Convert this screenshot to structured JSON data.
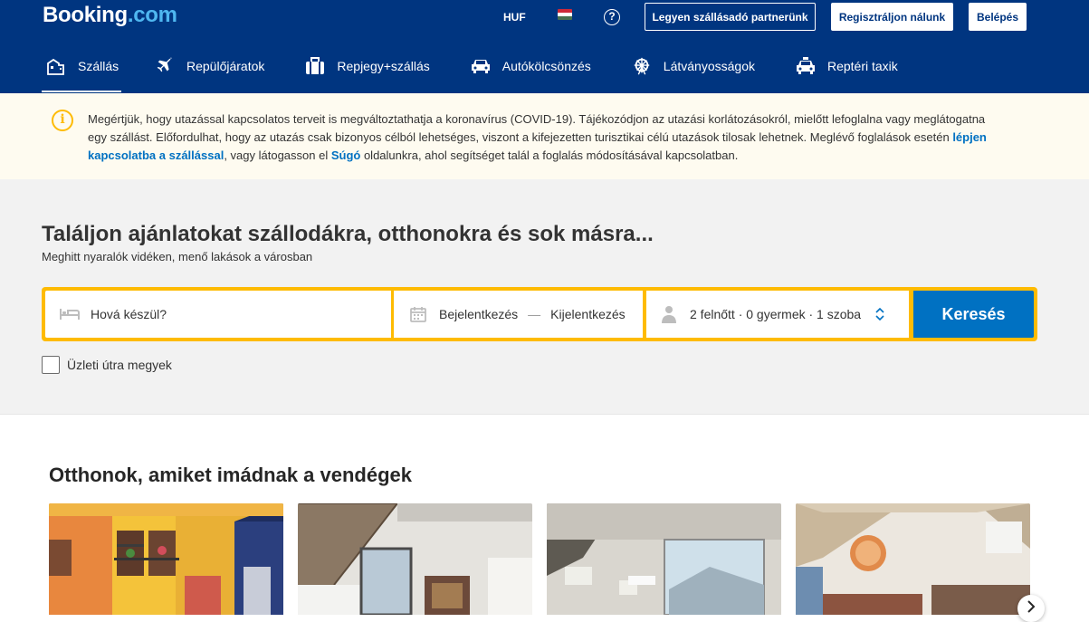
{
  "header": {
    "logo_main": "Booking",
    "logo_suffix": ".com",
    "currency": "HUF",
    "help": "?",
    "partner_button": "Legyen szállásadó partnerünk",
    "register_button": "Regisztráljon nálunk",
    "login_button": "Belépés"
  },
  "nav": {
    "items": [
      {
        "label": "Szállás",
        "icon": "bed-icon",
        "active": true
      },
      {
        "label": "Repülőjáratok",
        "icon": "plane-icon"
      },
      {
        "label": "Repjegy+szállás",
        "icon": "suitcase-icon"
      },
      {
        "label": "Autókölcsönzés",
        "icon": "car-icon"
      },
      {
        "label": "Látványosságok",
        "icon": "ferris-wheel-icon"
      },
      {
        "label": "Reptéri taxik",
        "icon": "taxi-icon"
      }
    ]
  },
  "notice": {
    "text_1": "Megértjük, hogy utazással kapcsolatos terveit is megváltoztathatja a koronavírus (COVID-19). Tájékozódjon az utazási korlátozásokról, mielőtt lefoglalna vagy meglátogatna egy szállást. Előfordulhat, hogy az utazás csak bizonyos célból lehetséges, viszont a kifejezetten turisztikai célú utazások tilosak lehetnek. Meglévő foglalások esetén ",
    "link_1": "lépjen kapcsolatba a szállással",
    "text_2": ", vagy látogasson el ",
    "link_2": "Súgó",
    "text_3": " oldalunkra, ahol segítséget talál a foglalás módosításával kapcsolatban."
  },
  "search": {
    "title": "Találjon ajánlatokat szállodákra, otthonokra és sok másra...",
    "subtitle": "Meghitt nyaralók vidéken, menő lakások a városban",
    "destination_placeholder": "Hová készül?",
    "checkin": "Bejelentkezés",
    "dash": "—",
    "checkout": "Kijelentkezés",
    "guests": "2 felnőtt · 0 gyermek · 1 szoba",
    "search_button": "Keresés",
    "business_trip": "Üzleti útra megyek"
  },
  "homes": {
    "title": "Otthonok, amiket imádnak a vendégek"
  },
  "colors": {
    "brand": "#003580",
    "accent": "#febb02",
    "button": "#0071c2"
  }
}
